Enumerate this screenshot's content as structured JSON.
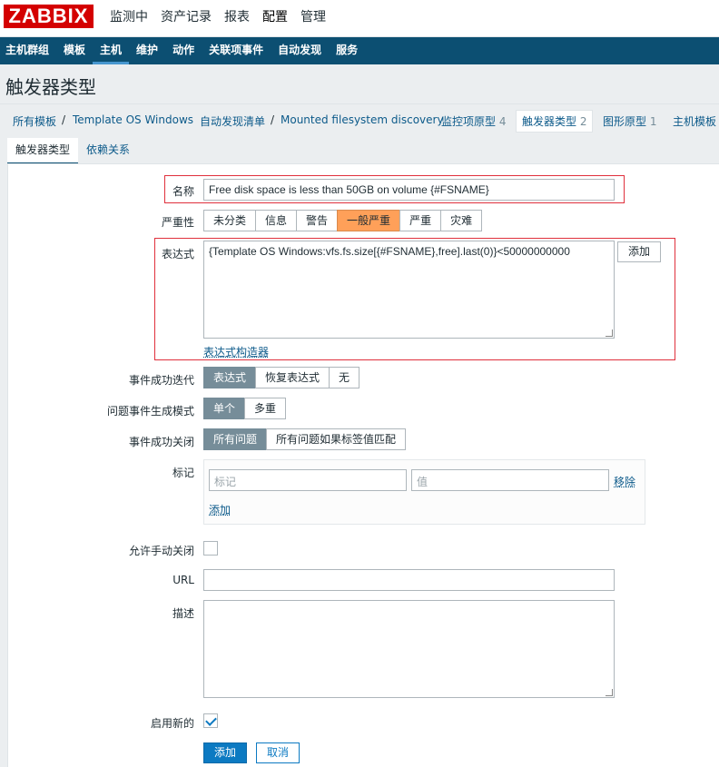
{
  "header": {
    "logo": "ZABBIX",
    "nav": [
      "监测中",
      "资产记录",
      "报表",
      "配置",
      "管理"
    ],
    "nav_active": "配置"
  },
  "subnav": {
    "items": [
      "主机群组",
      "模板",
      "主机",
      "维护",
      "动作",
      "关联项事件",
      "自动发现",
      "服务"
    ],
    "active": "主机"
  },
  "page_title": "触发器类型",
  "breadcrumb": {
    "all_templates": "所有模板",
    "template": "Template OS Windows",
    "discovery_list": "自动发现清单",
    "discovery_rule": "Mounted filesystem discovery",
    "item_prototypes": "监控项原型",
    "item_prototypes_count": "4",
    "trigger_prototypes": "触发器类型",
    "trigger_prototypes_count": "2",
    "graph_prototypes": "图形原型",
    "graph_prototypes_count": "1",
    "host_templates": "主机模板"
  },
  "tabs": [
    "触发器类型",
    "依赖关系"
  ],
  "form": {
    "name_label": "名称",
    "name_value": "Free disk space is less than 50GB on volume {#FSNAME}",
    "severity_label": "严重性",
    "severity_options": [
      "未分类",
      "信息",
      "警告",
      "一般严重",
      "严重",
      "灾难"
    ],
    "severity_selected": "一般严重",
    "expression_label": "表达式",
    "expression_value": "{Template OS Windows:vfs.fs.size[{#FSNAME},free].last(0)}<50000000000",
    "expression_add_button": "添加",
    "expression_builder_link": "表达式构造器",
    "ok_event_gen_label": "事件成功迭代",
    "ok_event_gen_options": [
      "表达式",
      "恢复表达式",
      "无"
    ],
    "ok_event_gen_selected": "表达式",
    "problem_mode_label": "问题事件生成模式",
    "problem_mode_options": [
      "单个",
      "多重"
    ],
    "problem_mode_selected": "单个",
    "ok_close_label": "事件成功关闭",
    "ok_close_options": [
      "所有问题",
      "所有问题如果标签值匹配"
    ],
    "ok_close_selected": "所有问题",
    "tags_label": "标记",
    "tag_placeholder": "标记",
    "value_placeholder": "值",
    "tag_remove": "移除",
    "tag_add": "添加",
    "manual_close_label": "允许手动关闭",
    "manual_close_checked": false,
    "url_label": "URL",
    "url_value": "",
    "description_label": "描述",
    "description_value": "",
    "enabled_label": "启用新的",
    "enabled_checked": true,
    "submit_button": "添加",
    "cancel_button": "取消"
  },
  "colors": {
    "brand_red": "#d40000",
    "subnav_bg": "#0c4f72",
    "primary": "#0c7ac2",
    "severity_average": "#ffa059",
    "selected_segment": "#768d99",
    "highlight_box": "#e0303c"
  }
}
